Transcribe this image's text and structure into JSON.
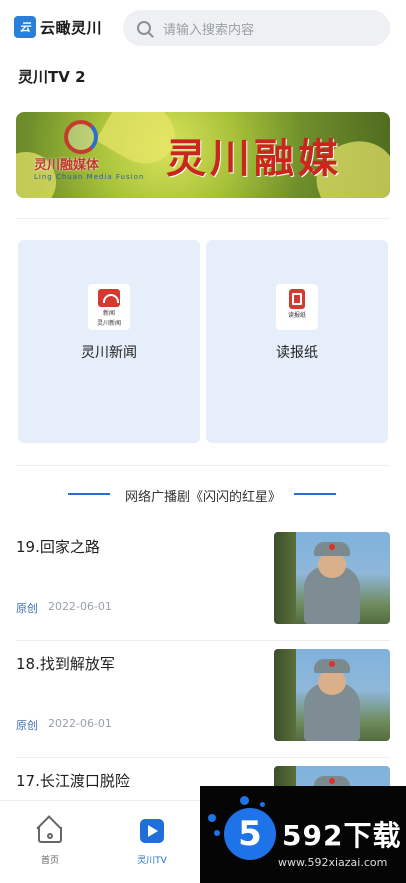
{
  "header": {
    "logo_mark": "云",
    "app_name": "云瞰灵川",
    "search_placeholder": "请输入搜索内容"
  },
  "channel": {
    "title": "灵川TV 2"
  },
  "banner": {
    "brand": "灵川融媒体",
    "subtitle": "Ling Chuan Media Fusion",
    "calligraphy": "灵川融媒"
  },
  "shortcuts": [
    {
      "label": "灵川新闻",
      "icon_caption_1": "新闻",
      "icon_caption_2": "灵川新闻",
      "icon": "news-icon"
    },
    {
      "label": "读报纸",
      "icon_caption_1": "读报纸",
      "icon": "newspaper-icon"
    }
  ],
  "section": {
    "title": "网络广播剧《闪闪的红星》"
  },
  "episodes": [
    {
      "title": "19.回家之路",
      "tag": "原创",
      "date": "2022-06-01"
    },
    {
      "title": "18.找到解放军",
      "tag": "原创",
      "date": "2022-06-01"
    },
    {
      "title": "17.长江渡口脱险",
      "tag": "",
      "date": ""
    }
  ],
  "tabbar": {
    "tabs": [
      {
        "label": "首页",
        "icon": "home-icon",
        "active": false
      },
      {
        "label": "灵川TV",
        "icon": "play-icon",
        "active": true
      }
    ]
  },
  "watermark": {
    "badge": "5",
    "brand": "592下载",
    "url": "www.592xiazai.com"
  },
  "colors": {
    "accent": "#1e6fd9",
    "card_bg": "#e6eef9",
    "search_bg": "#eef0f4",
    "tag": "#3d6fb3"
  }
}
